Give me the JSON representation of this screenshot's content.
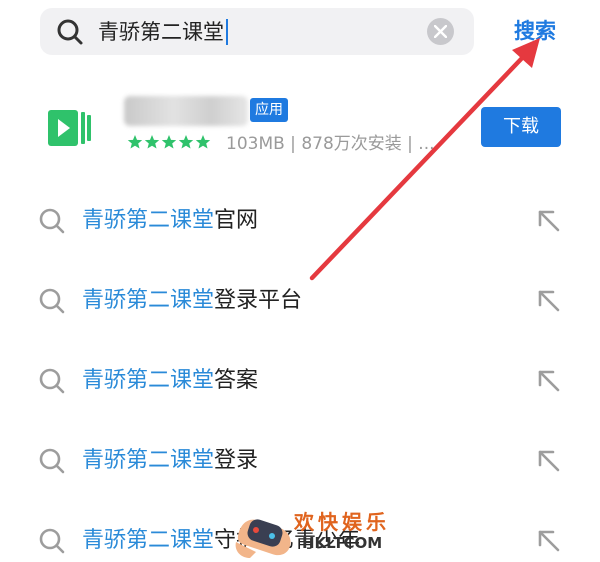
{
  "search": {
    "query": "青骄第二课堂",
    "submit_label": "搜索"
  },
  "app_result": {
    "tag": "应用",
    "rating_stars": 5,
    "meta": "103MB | 878万次安装 | ...",
    "download_label": "下载",
    "icon_color": "#2fc26b"
  },
  "suggestions": [
    {
      "highlight": "青骄第二课堂",
      "rest": "官网"
    },
    {
      "highlight": "青骄第二课堂",
      "rest": "登录平台"
    },
    {
      "highlight": "青骄第二课堂",
      "rest": "答案"
    },
    {
      "highlight": "青骄第二课堂",
      "rest": "登录"
    },
    {
      "highlight": "青骄第二课堂",
      "rest": "守护2亿青少年"
    }
  ],
  "watermark": {
    "text": "欢快娱乐",
    "domain": "HKLTCOM"
  },
  "colors": {
    "accent": "#1f7ae0",
    "highlight_text": "#2a8ad8",
    "arrow": "#e5393f"
  }
}
